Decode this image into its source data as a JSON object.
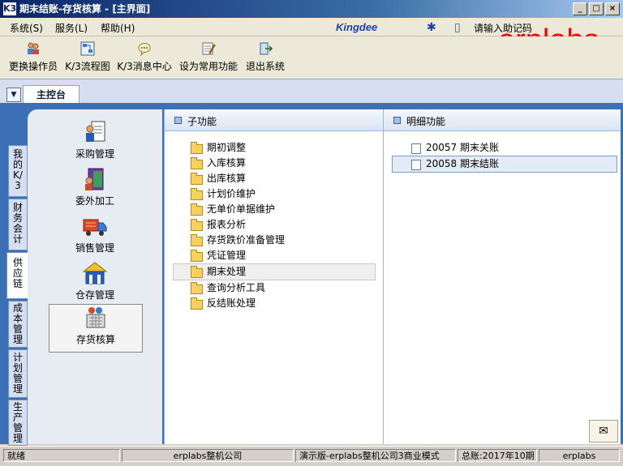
{
  "window": {
    "logo": "K3",
    "title": "期末结账-存货核算 - [主界面]",
    "buttons": [
      "_",
      "□",
      "×"
    ]
  },
  "menubar": {
    "items": [
      "系统(S)",
      "服务(L)",
      "帮助(H)"
    ],
    "brand": "Kingdee",
    "hint": "请输入助记码",
    "watermark": "erplabs"
  },
  "toolbar": {
    "buttons": [
      {
        "label": "更换操作员",
        "icon": "users-icon"
      },
      {
        "label": "K/3流程图",
        "icon": "flowchart-icon"
      },
      {
        "label": "K/3消息中心",
        "icon": "message-icon"
      },
      {
        "label": "设为常用功能",
        "icon": "favorite-icon"
      },
      {
        "label": "退出系统",
        "icon": "exit-icon"
      }
    ]
  },
  "tabs": {
    "main": "主控台"
  },
  "vertical_tabs": [
    {
      "label": "我的K/3"
    },
    {
      "label": "财务会计"
    },
    {
      "label": "供应链",
      "active": true
    },
    {
      "label": "成本管理"
    },
    {
      "label": "计划管理"
    },
    {
      "label": "生产管理"
    }
  ],
  "modules": [
    {
      "label": "采购管理",
      "icon": "purchase-icon"
    },
    {
      "label": "委外加工",
      "icon": "outsourcing-icon"
    },
    {
      "label": "销售管理",
      "icon": "sales-truck-icon"
    },
    {
      "label": "仓存管理",
      "icon": "warehouse-icon"
    },
    {
      "label": "存货核算",
      "icon": "inventory-accounting-icon",
      "selected": true
    }
  ],
  "subfunctions": {
    "header": "子功能",
    "items": [
      {
        "label": "期初调整"
      },
      {
        "label": "入库核算"
      },
      {
        "label": "出库核算"
      },
      {
        "label": "计划价维护"
      },
      {
        "label": "无单价单据维护"
      },
      {
        "label": "报表分析"
      },
      {
        "label": "存货跌价准备管理"
      },
      {
        "label": "凭证管理"
      },
      {
        "label": "期末处理",
        "selected": true
      },
      {
        "label": "查询分析工具"
      },
      {
        "label": "反结账处理"
      }
    ]
  },
  "details": {
    "header": "明细功能",
    "items": [
      {
        "code": "20057",
        "name": "期末关账"
      },
      {
        "code": "20058",
        "name": "期末结账",
        "selected": true
      }
    ]
  },
  "statusbar": {
    "status": "就绪",
    "company": "erplabs整机公司",
    "edition": "演示版-erplabs整机公司3商业模式",
    "ledger": "总账:2017年10期",
    "user": "erplabs"
  },
  "colors": {
    "titlebar": "#0a246a",
    "workarea": "#3b6fb6",
    "watermark": "#ff0000",
    "brand": "#1f3fa8"
  }
}
